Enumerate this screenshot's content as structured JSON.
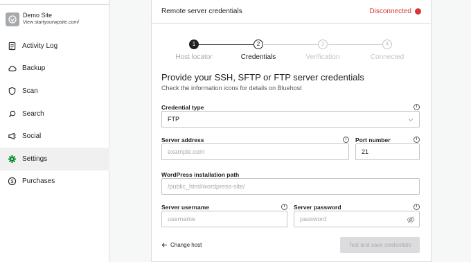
{
  "site": {
    "name": "Demo Site",
    "url": "View startyourwpsite.com/"
  },
  "nav": [
    {
      "label": "Activity Log",
      "icon": "activity-log-icon",
      "active": false
    },
    {
      "label": "Backup",
      "icon": "cloud-icon",
      "active": false
    },
    {
      "label": "Scan",
      "icon": "shield-icon",
      "active": false
    },
    {
      "label": "Search",
      "icon": "search-icon",
      "active": false
    },
    {
      "label": "Social",
      "icon": "megaphone-icon",
      "active": false
    },
    {
      "label": "Settings",
      "icon": "gear-icon",
      "active": true
    },
    {
      "label": "Purchases",
      "icon": "dollar-icon",
      "active": false
    }
  ],
  "panel": {
    "title": "Remote server credentials",
    "status": "Disconnected",
    "status_color": "#d63638"
  },
  "steps": [
    {
      "num": "1",
      "label": "Host locator",
      "state": "done"
    },
    {
      "num": "2",
      "label": "Credentials",
      "state": "current"
    },
    {
      "num": "3",
      "label": "Verification",
      "state": "todo"
    },
    {
      "num": "4",
      "label": "Connected",
      "state": "todo"
    }
  ],
  "form": {
    "heading": "Provide your SSH, SFTP or FTP server credentials",
    "subheading": "Check the information icons for details on Bluehost",
    "credential_type": {
      "label": "Credential type",
      "value": "FTP"
    },
    "server_address": {
      "label": "Server address",
      "placeholder": "example.com"
    },
    "port_number": {
      "label": "Port number",
      "value": "21"
    },
    "wp_path": {
      "label": "WordPress installation path",
      "placeholder": "/public_html/wordpress-site/"
    },
    "username": {
      "label": "Server username",
      "placeholder": "username"
    },
    "password": {
      "label": "Server password",
      "placeholder": "password"
    },
    "info_glyph": "i"
  },
  "actions": {
    "change_host": "Change host",
    "submit": "Test and save credentials"
  },
  "colors": {
    "accent_green": "#008a20",
    "error_red": "#d63638"
  }
}
